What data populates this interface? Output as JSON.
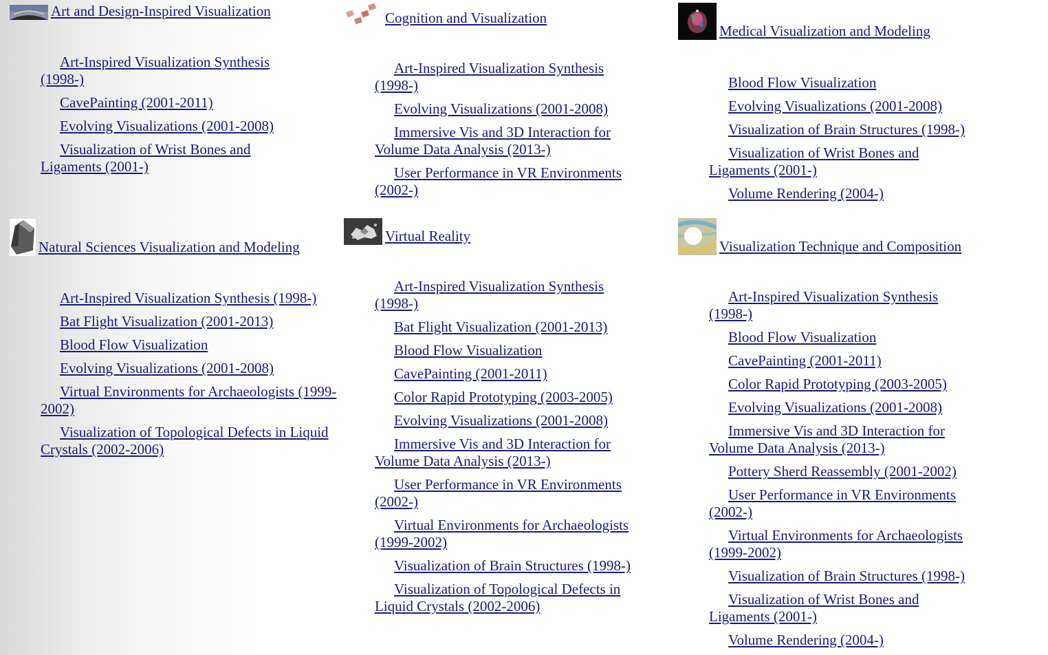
{
  "sections": [
    {
      "title": "Art and Design-Inspired Visualization",
      "thumb": "art-thumbnail-icon",
      "items": [
        "Art-Inspired Visualization Synthesis (1998-)",
        "CavePainting (2001-2011)",
        "Evolving Visualizations (2001-2008)",
        "Visualization of Wrist Bones and Ligaments (2001-)"
      ]
    },
    {
      "title": "Cognition and Visualization",
      "thumb": "cognition-thumbnail-icon",
      "items": [
        "Art-Inspired Visualization Synthesis (1998-)",
        "Evolving Visualizations (2001-2008)",
        "Immersive Vis and 3D Interaction for Volume Data Analysis (2013-)",
        "User Performance in VR Environments (2002-)"
      ]
    },
    {
      "title": "Medical Visualization and Modeling",
      "thumb": "medical-thumbnail-icon",
      "items": [
        "Blood Flow Visualization",
        "Evolving Visualizations (2001-2008)",
        "Visualization of Brain Structures (1998-)",
        "Visualization of Wrist Bones and Ligaments (2001-)",
        "Volume Rendering (2004-)"
      ]
    },
    {
      "title": "Natural Sciences Visualization and Modeling",
      "thumb": "natural-sciences-thumbnail-icon",
      "items": [
        "Art-Inspired Visualization Synthesis (1998-)",
        "Bat Flight Visualization (2001-2013)",
        "Blood Flow Visualization",
        "Evolving Visualizations (2001-2008)",
        "Virtual Environments for Archaeologists (1999-2002)",
        "Visualization of Topological Defects in Liquid Crystals (2002-2006)"
      ]
    },
    {
      "title": "Virtual Reality",
      "thumb": "virtual-reality-thumbnail-icon",
      "items": [
        "Art-Inspired Visualization Synthesis (1998-)",
        "Bat Flight Visualization (2001-2013)",
        "Blood Flow Visualization",
        "CavePainting (2001-2011)",
        "Color Rapid Prototyping (2003-2005)",
        "Evolving Visualizations (2001-2008)",
        "Immersive Vis and 3D Interaction for Volume Data Analysis (2013-)",
        "User Performance in VR Environments (2002-)",
        "Virtual Environments for Archaeologists (1999-2002)",
        "Visualization of Brain Structures (1998-)",
        "Visualization of Topological Defects in Liquid Crystals (2002-2006)"
      ]
    },
    {
      "title": "Visualization Technique and Composition",
      "thumb": "technique-thumbnail-icon",
      "items": [
        "Art-Inspired Visualization Synthesis (1998-)",
        "Blood Flow Visualization",
        "CavePainting (2001-2011)",
        "Color Rapid Prototyping (2003-2005)",
        "Evolving Visualizations (2001-2008)",
        "Immersive Vis and 3D Interaction for Volume Data Analysis (2013-)",
        "Pottery Sherd Reassembly (2001-2002)",
        "User Performance in VR Environments (2002-)",
        "Virtual Environments for Archaeologists (1999-2002)",
        "Visualization of Brain Structures (1998-)",
        "Visualization of Wrist Bones and Ligaments (2001-)",
        "Volume Rendering (2004-)"
      ]
    }
  ],
  "colors": {
    "link": "#1a1a7a",
    "background_gradient_start": "#d9d9d9",
    "background_gradient_end": "#ffffff"
  }
}
